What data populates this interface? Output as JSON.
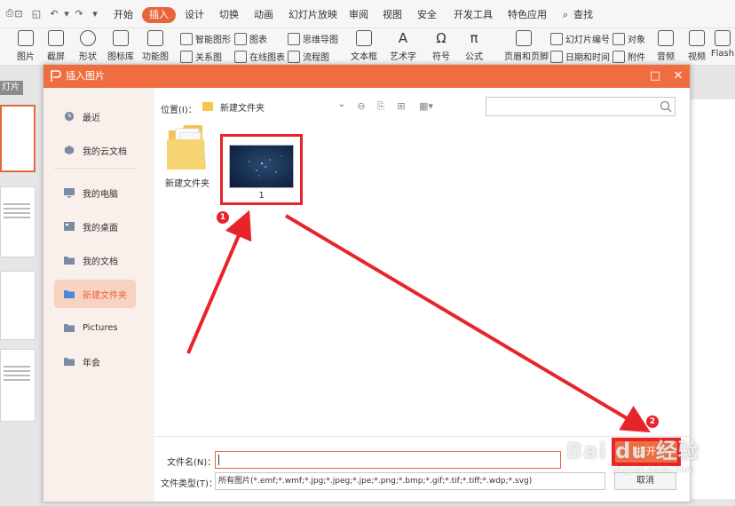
{
  "ribbon": {
    "tabs": [
      "开始",
      "插入",
      "设计",
      "切换",
      "动画",
      "幻灯片放映",
      "审阅",
      "视图",
      "安全",
      "开发工具",
      "特色应用",
      "查找"
    ],
    "active_tab": "插入",
    "accent_color": "#e8643a",
    "tools_large": [
      "图片",
      "截屏",
      "形状",
      "图标库",
      "功能图",
      "音频",
      "视频",
      "Flash"
    ],
    "tools_small": [
      "智能图形",
      "图表",
      "思维导图",
      "关系图",
      "在线图表",
      "流程图",
      "文本框",
      "艺术字",
      "符号",
      "公式",
      "页眉和页脚",
      "幻灯片编号",
      "对象",
      "日期和时间",
      "附件"
    ]
  },
  "background_doc": {
    "slide_tab": "灯片"
  },
  "dialog": {
    "title": "插入图片",
    "title_bg": "#f06d3f",
    "sidebar": [
      {
        "label": "最近",
        "icon": "clock-icon"
      },
      {
        "label": "我的云文档",
        "icon": "cloud-icon"
      },
      {
        "label": "我的电脑",
        "icon": "computer-icon"
      },
      {
        "label": "我的桌面",
        "icon": "desktop-icon"
      },
      {
        "label": "我的文档",
        "icon": "folder-icon"
      },
      {
        "label": "新建文件夹",
        "icon": "folder-icon",
        "active": true
      },
      {
        "label": "Pictures",
        "icon": "folder-icon"
      },
      {
        "label": "年会",
        "icon": "folder-icon"
      }
    ],
    "location_label": "位置(I)：",
    "location_value": "新建文件夹",
    "search_placeholder": "",
    "files": [
      {
        "name": "新建文件夹",
        "type": "folder"
      },
      {
        "name": "1",
        "type": "image",
        "selected": true
      }
    ],
    "filename_label": "文件名(N)：",
    "filename_value": "",
    "filetype_label": "文件类型(T)：",
    "filetype_value": "所有图片(*.emf;*.wmf;*.jpg;*.jpeg;*.jpe;*.png;*.bmp;*.gif;*.tif;*.tiff;*.wdp;*.svg)",
    "open_label": "打开",
    "cancel_label": "取消"
  },
  "annotations": {
    "marker_1": "1",
    "marker_2": "2",
    "highlight_color": "#e8242b"
  },
  "watermark": {
    "brand": "Bai du 经验",
    "url": "jingyan.baidu.com"
  }
}
